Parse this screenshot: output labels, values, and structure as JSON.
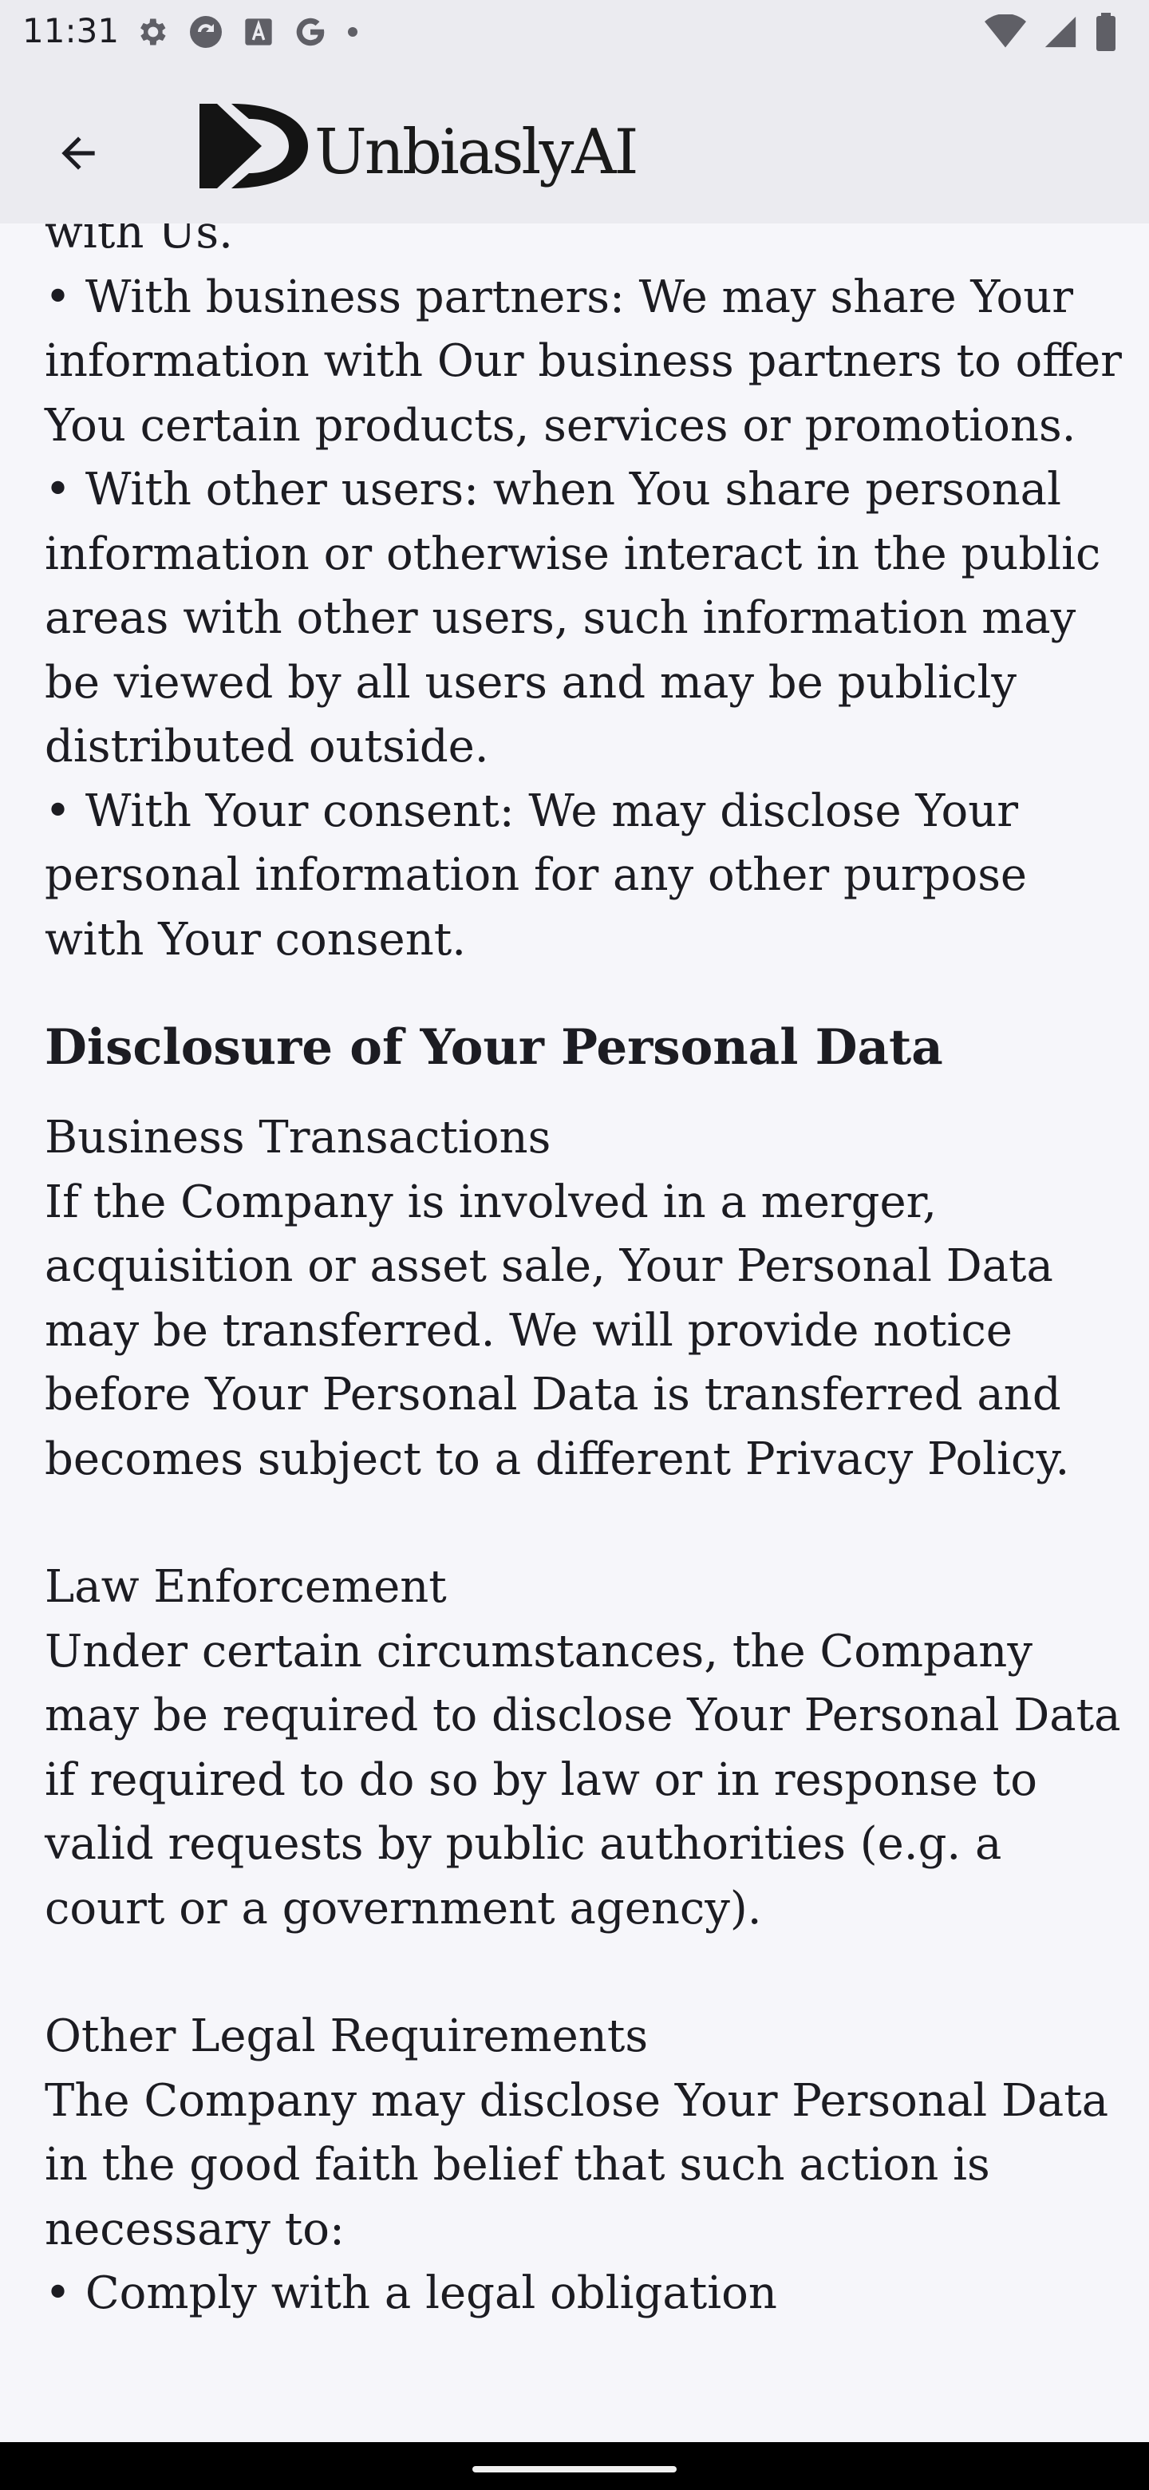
{
  "status_bar": {
    "time": "11:31",
    "icons": [
      "settings-icon",
      "sync-icon",
      "font-icon",
      "google-icon",
      "dot-icon"
    ],
    "right_icons": [
      "wifi-icon",
      "signal-icon",
      "battery-icon"
    ]
  },
  "app_bar": {
    "back_icon": "arrow-back-icon",
    "logo_text": "UnbiaslyAI"
  },
  "content": {
    "intro_lines": "with Us.\n• With business partners: We may share Your information with Our business partners to offer You certain products, services or promotions.\n• With other users: when You share personal information or otherwise interact in the public areas with other users, such information may be viewed by all users and may be publicly distributed outside.\n• With Your consent: We may disclose Your personal information for any other purpose with Your consent.",
    "heading": "Disclosure of Your Personal Data",
    "sections": [
      {
        "title": "Business Transactions",
        "body": "If the Company is involved in a merger, acquisition or asset sale, Your Personal Data may be transferred. We will provide notice before Your Personal Data is transferred and becomes subject to a different Privacy Policy."
      },
      {
        "title": "Law Enforcement",
        "body": "Under certain circumstances, the Company may be required to disclose Your Personal Data if required to do so by law or in response to valid requests by public authorities (e.g. a court or a government agency)."
      },
      {
        "title": "Other Legal Requirements",
        "body": "The Company may disclose Your Personal Data in the good faith belief that such action is necessary to:\n• Comply with a legal obligation"
      }
    ]
  }
}
